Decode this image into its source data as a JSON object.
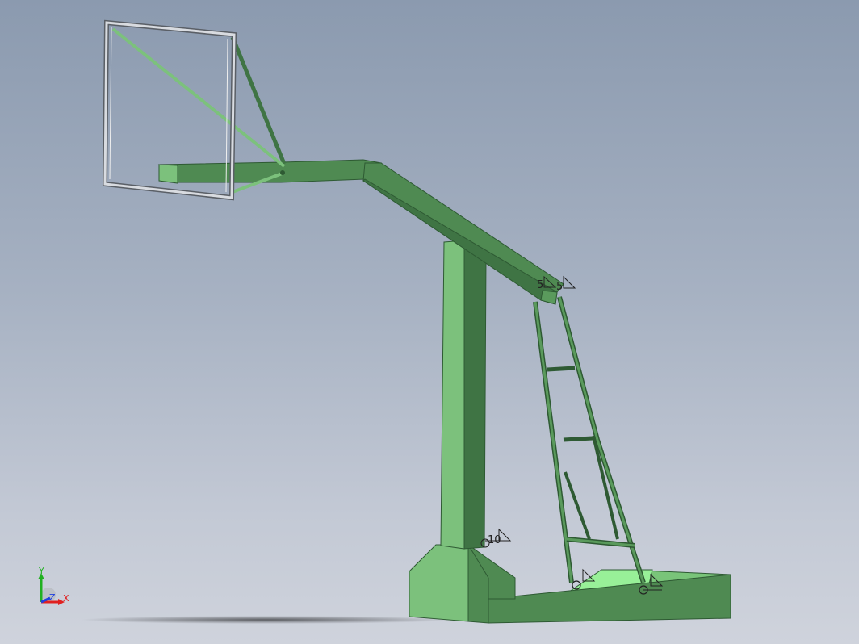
{
  "viewport": {
    "background_top": "#8b9aaf",
    "background_bottom": "#cfd3dc"
  },
  "model": {
    "name": "basketball-stand",
    "body_color": "#4f8a52",
    "light_face_color": "#7cc17c",
    "dark_face_color": "#3f7444",
    "highlight_color": "#98f098",
    "frame_color": "#b8bcc2"
  },
  "weld_symbols": [
    {
      "label": "5"
    },
    {
      "label": "5"
    },
    {
      "label": "10"
    },
    {
      "label": ""
    },
    {
      "label": ""
    }
  ],
  "triad": {
    "y_label": "Y",
    "z_label": "Z",
    "x_label": "X",
    "x_color": "#e02020",
    "y_color": "#20b020",
    "z_color": "#2040e0"
  }
}
